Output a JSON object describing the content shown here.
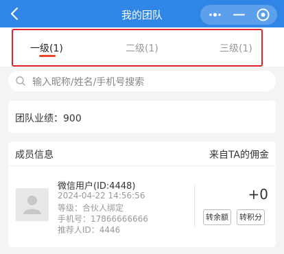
{
  "header": {
    "title": "我的团队",
    "back_icon": "chevron-left-icon",
    "capsule_icons": [
      "more-dots-icon",
      "minus-icon",
      "close-circle-icon"
    ]
  },
  "tabs": [
    {
      "label": "一级(1)",
      "active": true
    },
    {
      "label": "二级(1)",
      "active": false
    },
    {
      "label": "三级(1)",
      "active": false
    }
  ],
  "search": {
    "placeholder": "输入昵称/姓名/手机号搜索"
  },
  "performance": {
    "text": "团队业绩：900"
  },
  "members": {
    "header_left": "成员信息",
    "header_right": "来自TA的佣金",
    "items": [
      {
        "name": "微信用户(ID:4448)",
        "datetime": "2024-04-22 14:56:56",
        "level": "等级：合伙人绑定",
        "phone": "手机号：17866666666",
        "referrer": "推荐人ID：4446",
        "amount": "+0",
        "btn_balance": "转余额",
        "btn_points": "转积分"
      }
    ]
  },
  "colors": {
    "primary": "#2f86e6",
    "tab_underline": "#e8452b",
    "highlight_box": "#e2222a"
  }
}
